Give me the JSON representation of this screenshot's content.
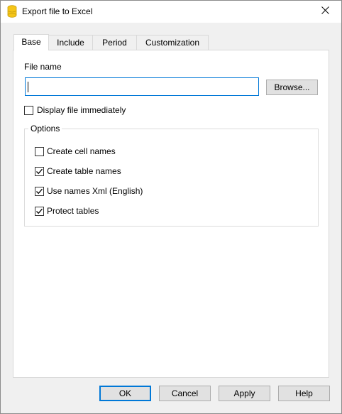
{
  "window": {
    "title": "Export file to Excel",
    "icon": "banana-app-icon",
    "close_icon": "close-icon"
  },
  "tabs": [
    {
      "label": "Base",
      "active": true
    },
    {
      "label": "Include",
      "active": false
    },
    {
      "label": "Period",
      "active": false
    },
    {
      "label": "Customization",
      "active": false
    }
  ],
  "base": {
    "file_name_label": "File name",
    "file_name_value": "",
    "browse_label": "Browse...",
    "display_file": {
      "label": "Display file immediately",
      "checked": false
    },
    "options": {
      "legend": "Options",
      "items": [
        {
          "label": "Create cell names",
          "checked": false
        },
        {
          "label": "Create table names",
          "checked": true
        },
        {
          "label": "Use names Xml (English)",
          "checked": true
        },
        {
          "label": "Protect tables",
          "checked": true
        }
      ]
    }
  },
  "buttons": {
    "ok": "OK",
    "cancel": "Cancel",
    "apply": "Apply",
    "help": "Help"
  },
  "colors": {
    "accent": "#0078d7",
    "icon_yellow": "#f5c518"
  }
}
